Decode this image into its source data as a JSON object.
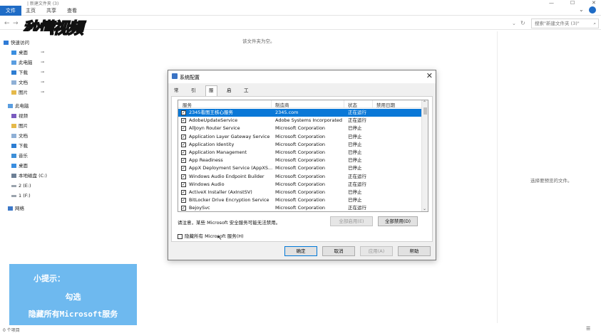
{
  "ribbon": {
    "path_fragment": "| 新建文件夹 (3)",
    "tabs": [
      "文件",
      "主页",
      "共享",
      "查看"
    ]
  },
  "address": {
    "search_placeholder": "搜索\"新建文件夹 (3)\""
  },
  "watermark": {
    "text": "秒懂视频"
  },
  "nav": {
    "quick_access": "快速访问",
    "quick_items": [
      "桌面",
      "此电脑",
      "下载",
      "文档",
      "图片"
    ],
    "this_pc": "此电脑",
    "pc_items": [
      "视频",
      "图片",
      "文档",
      "下载",
      "音乐",
      "桌面",
      "本地磁盘 (C:)",
      "2 (E:)",
      "1 (F:)"
    ],
    "network": "网络"
  },
  "main": {
    "empty_text": "该文件夹为空。",
    "preview_text": "选择要预览的文件。"
  },
  "status": {
    "items": "0 个项目"
  },
  "dialog": {
    "title": "系统配置",
    "tabs": [
      "常规",
      "引导",
      "服务",
      "启动",
      "工具"
    ],
    "active_tab": "服务",
    "columns": [
      "服务",
      "制造商",
      "状态",
      "禁用日期"
    ],
    "rows": [
      {
        "name": "2345看图王核心服务",
        "maker": "2345.com",
        "status": "正在运行",
        "checked": true,
        "selected": true
      },
      {
        "name": "AdobeUpdateService",
        "maker": "Adobe Systems Incorporated",
        "status": "正在运行",
        "checked": true
      },
      {
        "name": "AllJoyn Router Service",
        "maker": "Microsoft Corporation",
        "status": "已停止",
        "checked": true
      },
      {
        "name": "Application Layer Gateway Service",
        "maker": "Microsoft Corporation",
        "status": "已停止",
        "checked": true
      },
      {
        "name": "Application Identity",
        "maker": "Microsoft Corporation",
        "status": "已停止",
        "checked": true
      },
      {
        "name": "Application Management",
        "maker": "Microsoft Corporation",
        "status": "已停止",
        "checked": true
      },
      {
        "name": "App Readiness",
        "maker": "Microsoft Corporation",
        "status": "已停止",
        "checked": true
      },
      {
        "name": "AppX Deployment Service (AppXS...",
        "maker": "Microsoft Corporation",
        "status": "已停止",
        "checked": true
      },
      {
        "name": "Windows Audio Endpoint Builder",
        "maker": "Microsoft Corporation",
        "status": "正在运行",
        "checked": true
      },
      {
        "name": "Windows Audio",
        "maker": "Microsoft Corporation",
        "status": "正在运行",
        "checked": true
      },
      {
        "name": "ActiveX Installer (AxInstSV)",
        "maker": "Microsoft Corporation",
        "status": "已停止",
        "checked": true
      },
      {
        "name": "BitLocker Drive Encryption Service",
        "maker": "Microsoft Corporation",
        "status": "已停止",
        "checked": true
      },
      {
        "name": "BejoySvc",
        "maker": "Microsoft Corporation",
        "status": "正在运行",
        "checked": true
      }
    ],
    "note": "请注意，某些 Microsoft 安全服务可能无法禁用。",
    "enable_all": "全部启用(E)",
    "disable_all": "全部禁用(D)",
    "hide_ms": "隐藏所有 Microsoft 服务(H)",
    "ok": "确定",
    "cancel": "取消",
    "apply": "应用(A)",
    "help": "帮助"
  },
  "tip": {
    "line1": "小提示：",
    "line2": "勾选",
    "line3": "隐藏所有Microsoft服务"
  },
  "colors": {
    "accent": "#1f6cc6",
    "selection": "#0a78d7",
    "tip_bg": "#6eb9ef"
  }
}
